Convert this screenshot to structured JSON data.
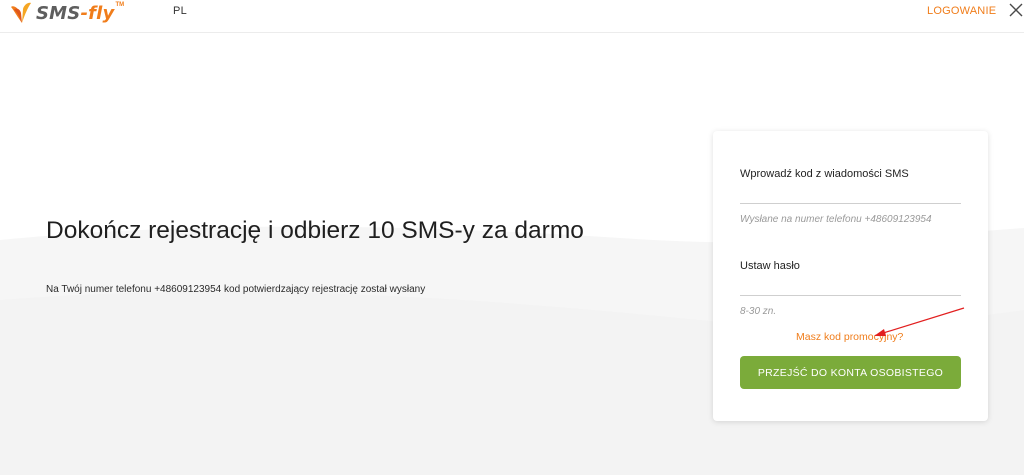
{
  "header": {
    "logo_text_dark": "SMS",
    "logo_text_accent": "-fly",
    "logo_tm": "TM",
    "language": "PL",
    "login_label": "LOGOWANIE",
    "close_icon": "close-icon"
  },
  "hero": {
    "title": "Dokończ rejestrację i odbierz 10 SMS-y za darmo",
    "subtitle": "Na Twój numer telefonu +48609123954 kod potwierdzający rejestrację został wysłany"
  },
  "form": {
    "sms_code_label": "Wprowadź kod z wiadomości SMS",
    "sms_code_value": "",
    "sms_hint": "Wysłane na numer telefonu +48609123954",
    "password_label": "Ustaw hasło",
    "password_value": "",
    "password_hint": "8-30 zn.",
    "promo_link": "Masz kod promocyjny?",
    "submit_label": "PRZEJŚĆ DO KONTA OSOBISTEGO"
  },
  "colors": {
    "accent_orange": "#f07d1b",
    "button_green": "#7bab3a",
    "annotation_red": "#e21f1f"
  }
}
